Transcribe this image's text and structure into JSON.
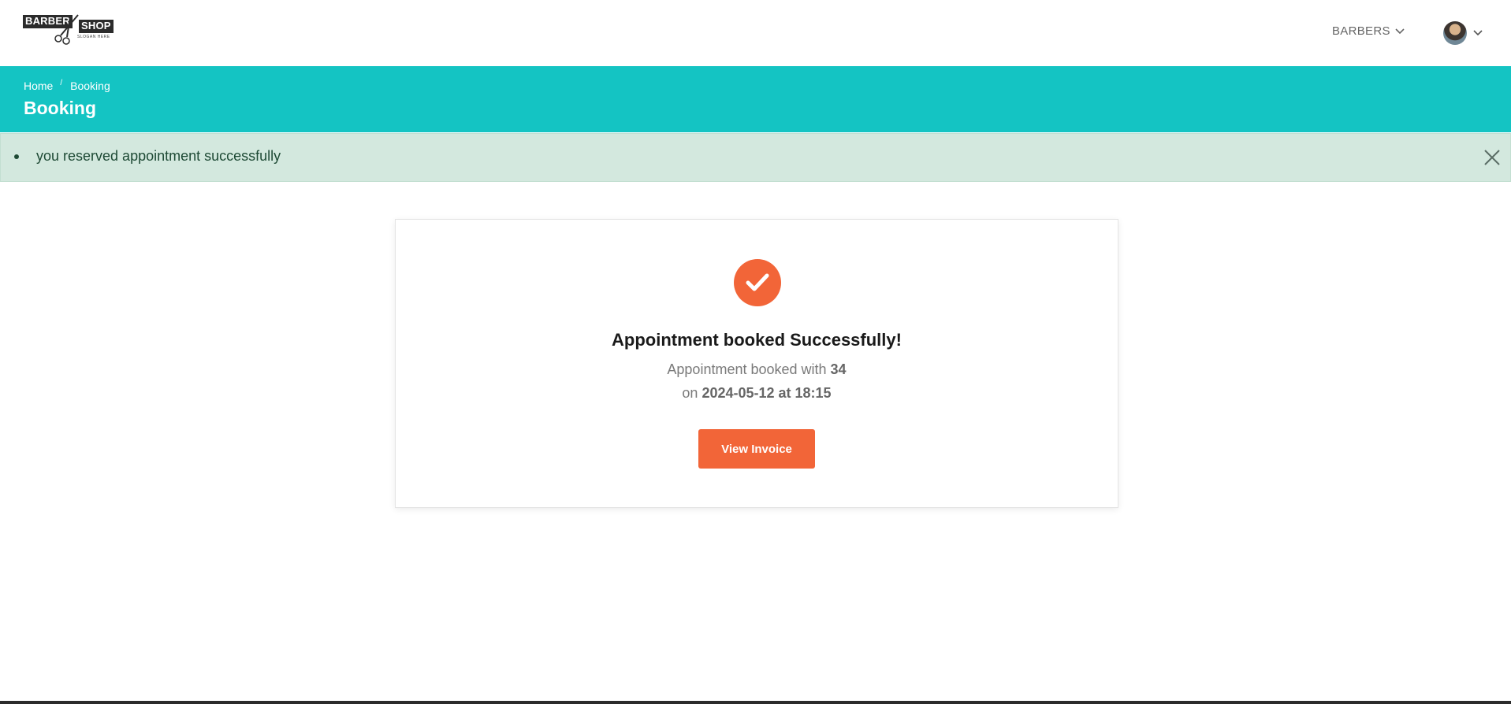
{
  "logo": {
    "word1": "BARBER",
    "word2": "SHOP",
    "slogan": "SLOGAN HERE"
  },
  "nav": {
    "barbers_label": "BARBERS"
  },
  "breadcrumb": {
    "home": "Home",
    "separator": "/",
    "current": "Booking"
  },
  "page": {
    "title": "Booking"
  },
  "alert": {
    "message": "you reserved appointment successfully"
  },
  "card": {
    "title": "Appointment booked Successfully!",
    "line1_prefix": "Appointment booked with ",
    "barber": "34",
    "line2_prefix": "on ",
    "datetime": "2024-05-12 at 18:15",
    "button_label": "View Invoice"
  },
  "colors": {
    "teal": "#14c4c3",
    "accent": "#f26538",
    "alert_bg": "#d3e8de"
  },
  "icons": [
    "scissors-icon",
    "chevron-down-icon",
    "close-icon",
    "checkmark-icon"
  ]
}
